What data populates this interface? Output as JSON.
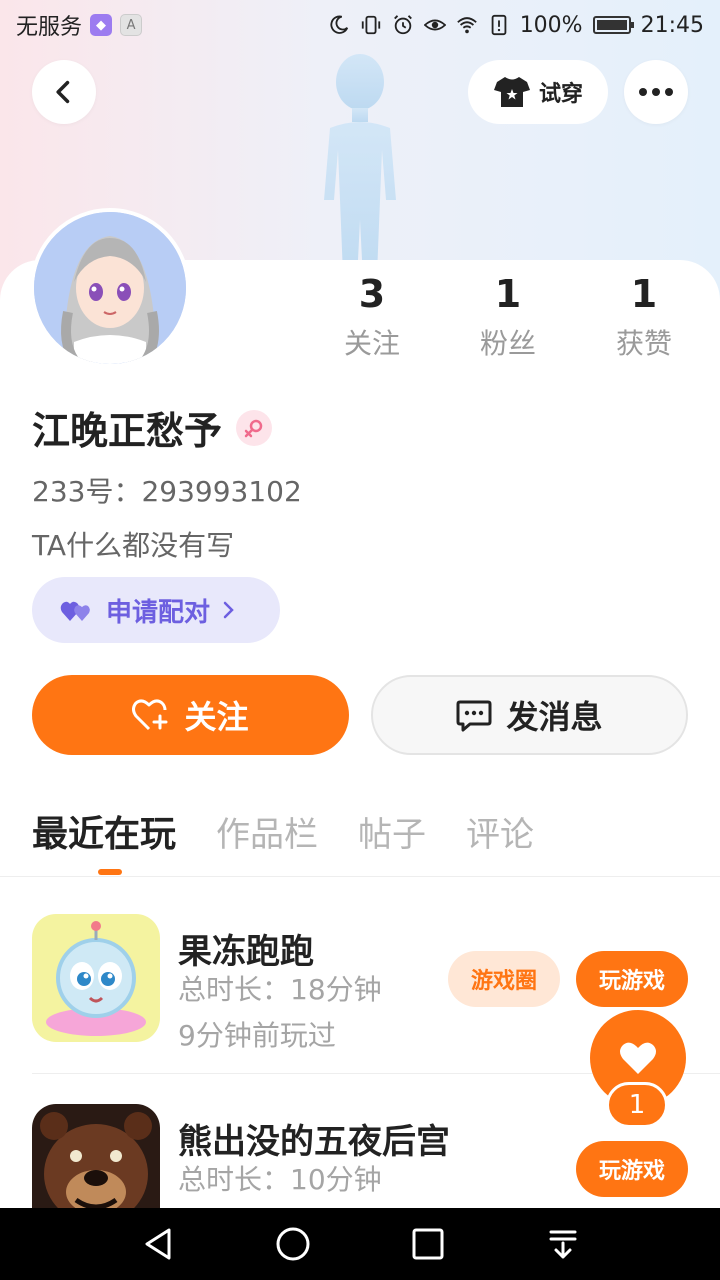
{
  "status_bar": {
    "carrier": "无服务",
    "badge_gray": "A",
    "battery": "100%",
    "battery_level": 1.0,
    "time": "21:45"
  },
  "header": {
    "try_on_label": "试穿",
    "back_icon": "chevron-left-icon",
    "more_icon": "more-dots-icon"
  },
  "profile": {
    "stats": [
      {
        "value": "3",
        "label": "关注"
      },
      {
        "value": "1",
        "label": "粉丝"
      },
      {
        "value": "1",
        "label": "获赞"
      }
    ],
    "name": "江晚正愁予",
    "gender_icon": "female-icon",
    "id_text": "233号：293993102",
    "bio": "TA什么都没有写",
    "pair_button": "申请配对"
  },
  "actions": {
    "follow": "关注",
    "message": "发消息"
  },
  "tabs": [
    "最近在玩",
    "作品栏",
    "帖子",
    "评论"
  ],
  "games": [
    {
      "title": "果冻跑跑",
      "duration": "总时长：18分钟",
      "last_played": "9分钟前玩过",
      "circle_button": "游戏圈",
      "play_button": "玩游戏"
    },
    {
      "title": "熊出没的五夜后宫",
      "duration": "总时长：10分钟",
      "play_button": "玩游戏"
    }
  ],
  "fab": {
    "count": "1"
  },
  "colors": {
    "accent": "#ff7513",
    "pair_purple": "#6d5fe0",
    "pair_bg": "#e8e8fb",
    "muted_text": "#a5a5a5"
  }
}
